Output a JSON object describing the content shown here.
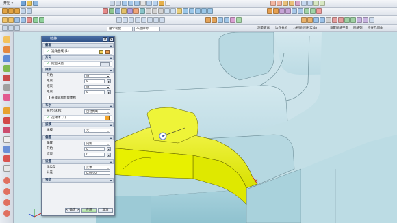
{
  "menubar": {
    "start_label": "开始 ▾"
  },
  "toolbar": {
    "dropdown_filter": "整个装配",
    "dropdown_snap": "不选择零",
    "label_measure": "测量距离",
    "label_analysis": "边界分析",
    "label_show": "九视图(图形实体)",
    "label_settings": "设置图纸平面",
    "label_grid": "图纸列",
    "label_view": "检查几何体"
  },
  "dialog": {
    "title": "拉伸",
    "sections": {
      "section": "截面",
      "direction": "方向",
      "limits": "限制",
      "boolean": "布尔",
      "draft": "拔模",
      "offset": "偏置",
      "settings": "设置",
      "preview": "预览"
    },
    "select_curve": "选择曲线 (1)",
    "specify_vector": "指定矢量",
    "limits": {
      "start_label": "开始",
      "start_type": "值",
      "start_dist_label": "距离",
      "start_dist": "0",
      "end_label": "结束",
      "end_type": "值",
      "end_dist_label": "距离",
      "end_dist": "0",
      "open_profile": "开放轮廓智能体积"
    },
    "boolean": {
      "label": "布尔 (求和)",
      "value": "自动判断",
      "select_body": "选择体 (1)"
    },
    "draft": {
      "label": "拔模",
      "value": "无"
    },
    "offset": {
      "label": "偏置",
      "value": "内侧",
      "start_label": "开始",
      "start_val": "0",
      "end_label": "结束",
      "end_val": "0"
    },
    "settings": {
      "body_type_label": "体类型",
      "body_type": "实体",
      "tolerance_label": "公差",
      "tolerance": "0.0010"
    },
    "buttons": {
      "ok": "< 确定 >",
      "apply": "应用",
      "cancel": "取消"
    }
  },
  "colors": {
    "accent": "#2d4f84",
    "model": "#a9d4df",
    "selection": "#e6f000"
  }
}
